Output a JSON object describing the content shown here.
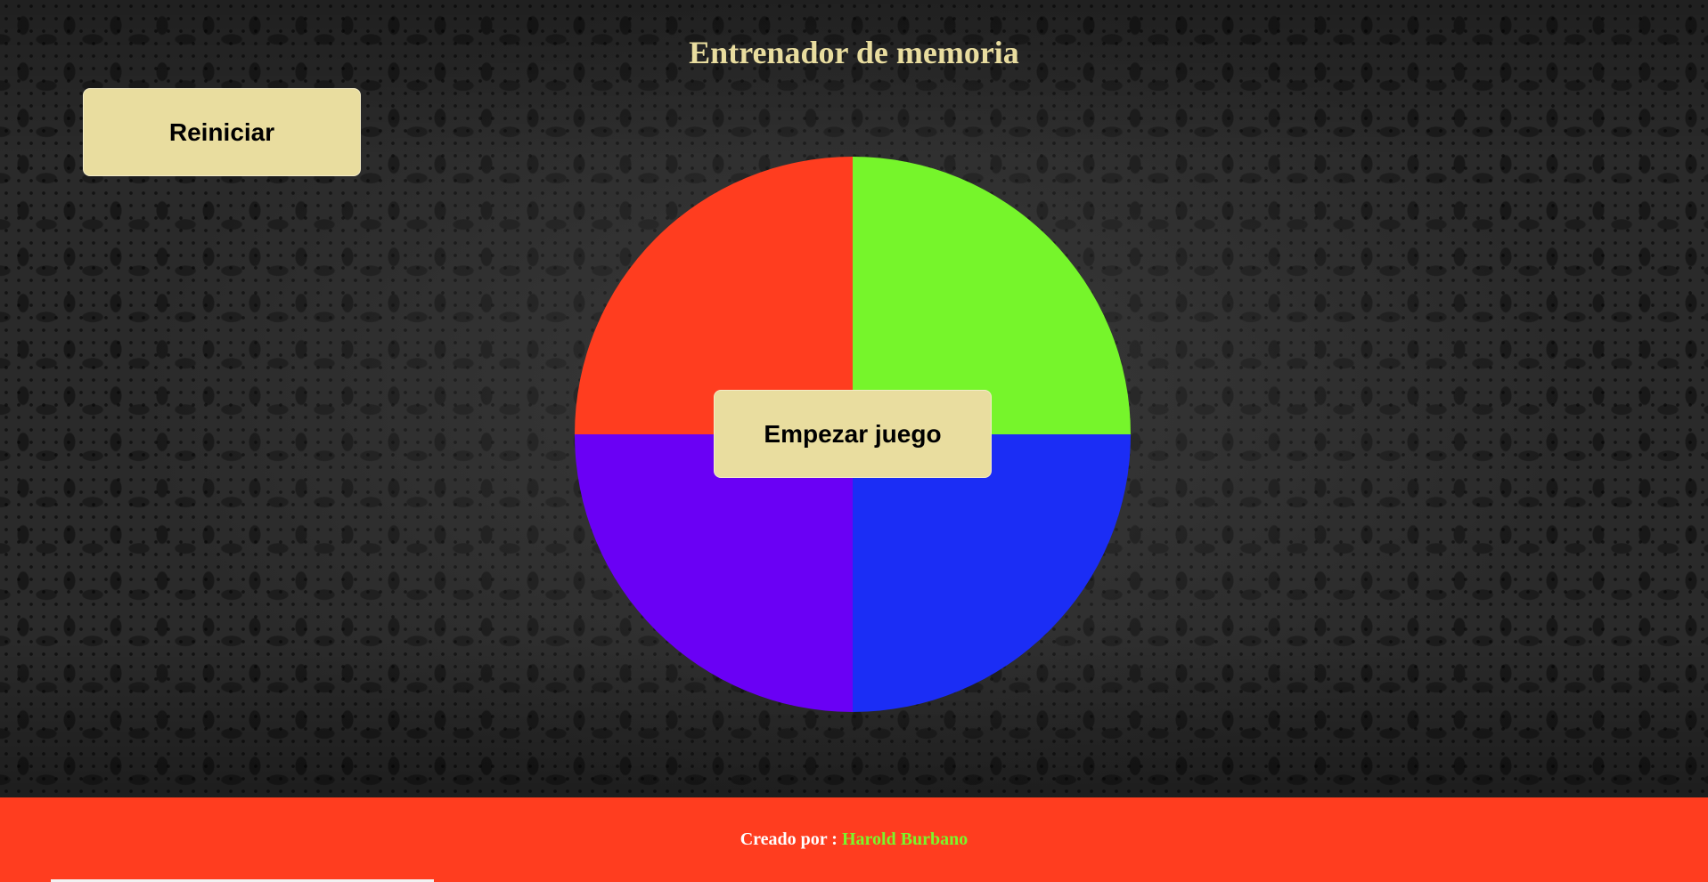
{
  "header": {
    "title": "Entrenador de memoria"
  },
  "controls": {
    "restart_label": "Reiniciar",
    "start_label": "Empezar juego"
  },
  "board": {
    "quadrants": [
      {
        "name": "red",
        "color": "#ff3d1f"
      },
      {
        "name": "green",
        "color": "#76f52b"
      },
      {
        "name": "purple",
        "color": "#6a00f5"
      },
      {
        "name": "blue",
        "color": "#1b2df5"
      }
    ]
  },
  "footer": {
    "label": "Creado por : ",
    "author": "Harold Burbano",
    "background": "#ff3d1f",
    "author_color": "#7cf52b"
  },
  "colors": {
    "button_bg": "#e9dd9f",
    "title_color": "#e9dd9f"
  }
}
